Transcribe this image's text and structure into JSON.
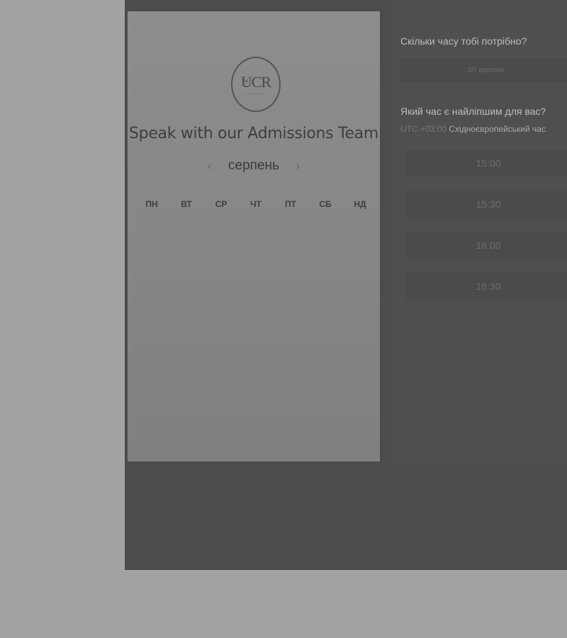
{
  "booking": {
    "logo_text": "UCR",
    "logo_prefix": "the",
    "title": "Speak with our Admissions Team",
    "calendar": {
      "month": "серпень",
      "prev_icon": "chevron-left-icon",
      "next_icon": "chevron-right-icon",
      "weekdays": [
        "ПН",
        "ВТ",
        "СР",
        "ЧТ",
        "ПТ",
        "СБ",
        "НД"
      ]
    },
    "duration": {
      "question": "Скільки часу тобі потрібно?",
      "value": "30 хвилин"
    },
    "time": {
      "question": "Який час є найліпшим для вас?",
      "timezone_offset": "UTC +03:00",
      "timezone_name": "Східноєвропейський час",
      "slots": [
        "15:00",
        "15:30",
        "16:00",
        "16:30"
      ]
    }
  }
}
